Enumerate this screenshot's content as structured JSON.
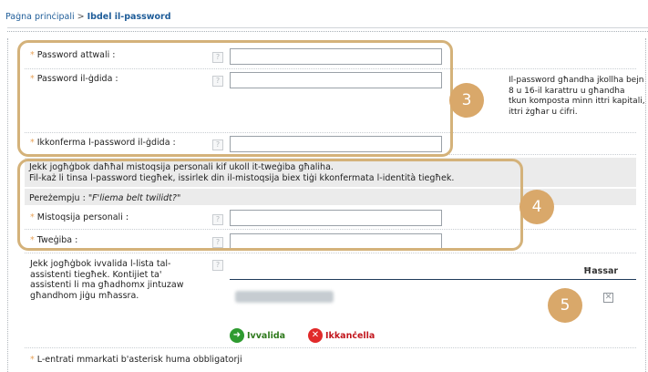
{
  "breadcrumb": {
    "home": "Paġna prinċipali",
    "separator": ">",
    "current": "Ibdel il-password"
  },
  "form": {
    "current_password_label": "Password attwali :",
    "new_password_label": "Password il-ġdida :",
    "confirm_password_label": "Ikkonferma l-password il-ġdida :",
    "help_glyph": "?",
    "required_mark": "*",
    "current_password_value": "",
    "new_password_value": "",
    "confirm_password_value": "",
    "password_hint": "Il-password għandha jkollha bejn 8 u 16-il karattru u għandha tkun komposta minn ittri kapitali, ittri żgħar u ċifri."
  },
  "personal_question": {
    "info_line1": "Jekk jogħġbok daħħal mistoqsija personali kif ukoll it-tweġiba għaliha.",
    "info_line2": "Fil-każ li tinsa l-password tiegħek, issirlek din il-mistoqsija biex tiġi kkonfermata l-identità tiegħek.",
    "example_label": "Pereżempju :",
    "example_text": "\"F'liema belt twilidt?\"",
    "question_label": "Mistoqsija personali :",
    "answer_label": "Tweġiba :",
    "question_value": "",
    "answer_value": ""
  },
  "assistants": {
    "info": "Jekk jogħġbok ivvalida l-lista tal-assistenti tiegħek. Kontijiet ta' assistenti li ma għadhomx jintuzaw għandhom jiġu mħassra.",
    "remove_header": "Ħassar",
    "remove_glyph": "✕"
  },
  "actions": {
    "validate_label": "Ivvalida",
    "validate_glyph": "➜",
    "cancel_label": "Ikkanċella",
    "cancel_glyph": "✕"
  },
  "footnote": "L-entrati mmarkati b'asterisk huma obbligatorji",
  "callouts": {
    "one": "3",
    "two": "4",
    "three": "5"
  },
  "colors": {
    "link": "#1f5d99",
    "callout": "#d9a86a",
    "validate": "#2e9b30",
    "cancel": "#e12a2a"
  }
}
